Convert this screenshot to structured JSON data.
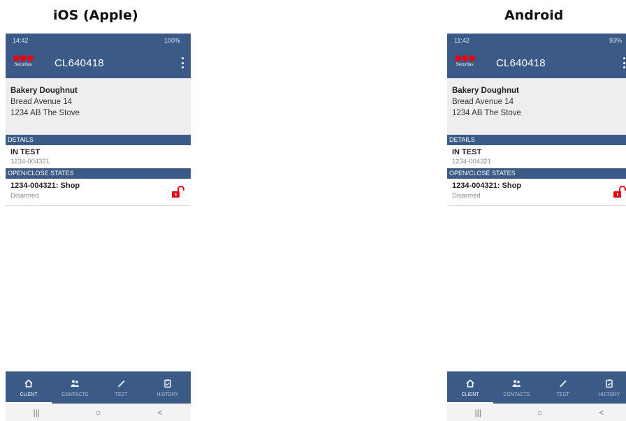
{
  "headings": {
    "ios": "iOS (Apple)",
    "android": "Android"
  },
  "ios": {
    "status": {
      "time": "14:42",
      "right": "100%"
    },
    "appbar": {
      "logo_text": "Securitas",
      "title": "CL640418"
    },
    "client": {
      "name": "Bakery Doughnut",
      "address1": "Bread Avenue 14",
      "address2": "1234 AB The Stove"
    },
    "details": {
      "header": "DETAILS",
      "title": "IN TEST",
      "subtitle": "1234-004321"
    },
    "states": {
      "header": "OPEN/CLOSE STATES",
      "title": "1234-004321: Shop",
      "subtitle": "Disarmed"
    },
    "tabs": [
      {
        "label": "CLIENT",
        "icon": "home-icon"
      },
      {
        "label": "CONTACTS",
        "icon": "people-icon"
      },
      {
        "label": "TEST",
        "icon": "pencil-icon"
      },
      {
        "label": "HISTORY",
        "icon": "clipboard-icon"
      }
    ],
    "nav": {
      "recents": "|||",
      "home": "○",
      "back": "<"
    }
  },
  "android": {
    "status": {
      "time": "11:42",
      "right": "93%"
    },
    "appbar": {
      "logo_text": "Securitas",
      "title": "CL640418"
    },
    "client": {
      "name": "Bakery Doughnut",
      "address1": "Bread Avenue 14",
      "address2": "1234 AB The Stove"
    },
    "details": {
      "header": "DETAILS",
      "title": "IN TEST",
      "subtitle": "1234-004321"
    },
    "states": {
      "header": "OPEN/CLOSE STATES",
      "title": "1234-004321: Shop",
      "subtitle": "Disarmed"
    },
    "tabs": [
      {
        "label": "CLIENT",
        "icon": "home-icon"
      },
      {
        "label": "CONTACTS",
        "icon": "people-icon"
      },
      {
        "label": "TEST",
        "icon": "pencil-icon"
      },
      {
        "label": "HISTORY",
        "icon": "clipboard-icon"
      }
    ],
    "nav": {
      "recents": "|||",
      "home": "○",
      "back": "<"
    }
  },
  "colors": {
    "primary": "#3b5a85",
    "brand_red": "#e30613",
    "card_bg": "#eeeeee"
  }
}
